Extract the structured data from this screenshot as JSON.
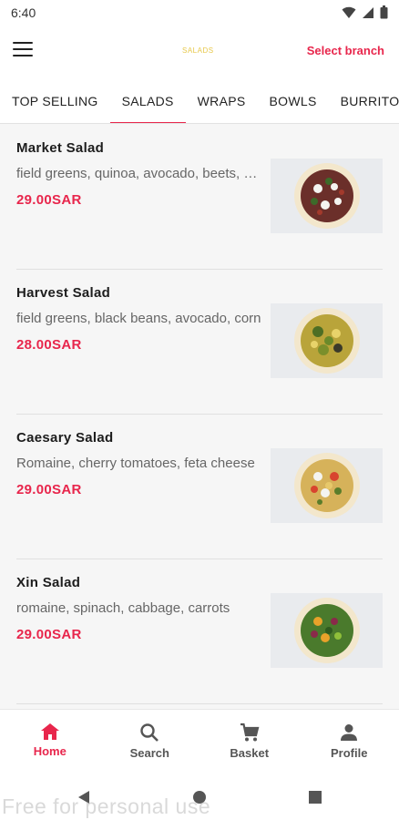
{
  "status_bar": {
    "time": "6:40"
  },
  "header": {
    "logo_text": "SALADS",
    "branch_label": "Select branch"
  },
  "tabs": [
    {
      "label": "TOP SELLING",
      "active": false
    },
    {
      "label": "SALADS",
      "active": true
    },
    {
      "label": "WRAPS",
      "active": false
    },
    {
      "label": "BOWLS",
      "active": false
    },
    {
      "label": "BURRITOS",
      "active": false
    }
  ],
  "menu_items": [
    {
      "title": "Market Salad",
      "description": "field greens, quinoa, avocado, beets, goat cheese",
      "price": "29.00SAR"
    },
    {
      "title": "Harvest Salad",
      "description": "field greens, black beans, avocado, corn",
      "price": "28.00SAR"
    },
    {
      "title": "Caesary Salad",
      "description": "Romaine, cherry tomatoes, feta cheese",
      "price": "29.00SAR"
    },
    {
      "title": "Xin Salad",
      "description": "romaine, spinach, cabbage, carrots",
      "price": "29.00SAR"
    }
  ],
  "bottom_nav": [
    {
      "label": "Home",
      "icon": "home-icon",
      "active": true
    },
    {
      "label": "Search",
      "icon": "search-icon",
      "active": false
    },
    {
      "label": "Basket",
      "icon": "cart-icon",
      "active": false
    },
    {
      "label": "Profile",
      "icon": "person-icon",
      "active": false
    }
  ],
  "watermark": "Free for personal use",
  "colors": {
    "accent": "#e8264c",
    "background": "#f6f6f6",
    "logo": "#e7c84a"
  }
}
